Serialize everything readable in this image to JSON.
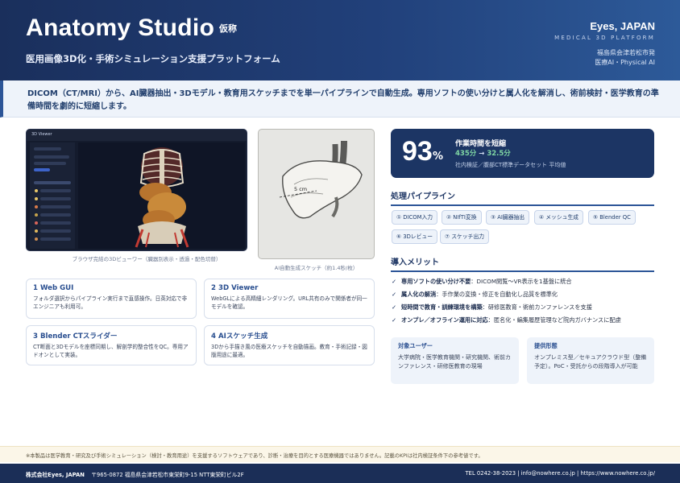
{
  "header": {
    "title": "Anatomy Studio",
    "tag": "仮称",
    "subtitle": "医用画像3D化・手術シミュレーション支援プラットフォーム",
    "company": "Eyes, JAPAN",
    "platform": "MEDICAL 3D PLATFORM",
    "origin": "福島県会津若松市発",
    "focus": "医療AI・Physical AI"
  },
  "lead": "DICOM（CT/MRI）から、AI臓器抽出・3Dモデル・教育用スケッチまでを単一パイプラインで自動生成。専用ソフトの使い分けと属人化を解消し、術前検討・医学教育の準備時間を劇的に短縮します。",
  "viewer": {
    "caption": "ブラウザ完結の3Dビューワー（臓器別表示・透過・配色切替）",
    "app_label": "3D Viewer"
  },
  "sketch": {
    "caption": "AI自動生成スケッチ（約1.4秒/枚）",
    "measure_label": "5 cm"
  },
  "features": [
    {
      "title": "1  Web GUI",
      "body": "フォルダ選択からパイプライン実行まで直感操作。日英対応で非エンジニアも利用可。"
    },
    {
      "title": "2  3D Viewer",
      "body": "WebGLによる高精細レンダリング。URL共有のみで関係者が同一モデルを確認。"
    },
    {
      "title": "3  Blender CTスライダー",
      "body": "CT断面と3Dモデルを座標同期し、解剖学的整合性をQC。専用アドオンとして実装。"
    },
    {
      "title": "4  AIスケッチ生成",
      "body": "3Dから手描き風の医療スケッチを自動描画。教育・手術記録・図版用途に最適。"
    }
  ],
  "kpi": {
    "value": "93",
    "unit": "%",
    "label": "作業時間を短縮",
    "before": "435分",
    "arrow": "→",
    "after": "32.5分",
    "note": "社内検証／腹部CT標準データセット 平均値"
  },
  "pipeline": {
    "title": "処理パイプライン",
    "steps": [
      "① DICOM入力",
      "② NIfTI変換",
      "③ AI臓器抽出",
      "④ メッシュ生成",
      "⑤ Blender QC",
      "⑥ 3Dレビュー",
      "⑦ スケッチ出力"
    ]
  },
  "merits": {
    "title": "導入メリット",
    "items": [
      {
        "head": "専用ソフトの使い分け不要",
        "body": "：DICOM閲覧〜VR表示を1基盤に統合"
      },
      {
        "head": "属人化の解消",
        "body": "：手作業の変換・修正を自動化し品質を標準化"
      },
      {
        "head": "短時間で教育・訓練環境を構築",
        "body": "：研修医教育・術前カンファレンスを支援"
      },
      {
        "head": "オンプレ／オフライン運用に対応",
        "body": "：匿名化・編集履歴管理など院内ガバナンスに配慮"
      }
    ],
    "check": "✓"
  },
  "target_users": {
    "title": "対象ユーザー",
    "body": "大学病院・医学教育機関・研究機関、術前カンファレンス・研修医教育の現場"
  },
  "offering": {
    "title": "提供形態",
    "body": "オンプレミス型／セキュアクラウド型（整備予定）。PoC・受託からの段階導入が可能"
  },
  "disclaimer": "※本製品は医学教育・研究及び手術シミュレーション（検討・教育用途）を支援するソフトウェアであり、診断・治療を目的とする医療機器ではありません。記載のKPIは社内検証条件下の参考値です。",
  "footer": {
    "company": "株式会社Eyes, JAPAN",
    "address": "〒965-0872 福島県会津若松市東栄町9-15 NTT東栄町ビル2F",
    "contact": "TEL 0242-38-2023  |  info@nowhere.co.jp  |  https://www.nowhere.co.jp/"
  },
  "colors": {
    "navy": "#1b2e57",
    "accent_blue": "#2c5597",
    "kpi_green": "#7fd6a3",
    "panel_bg": "#eef3fa"
  }
}
